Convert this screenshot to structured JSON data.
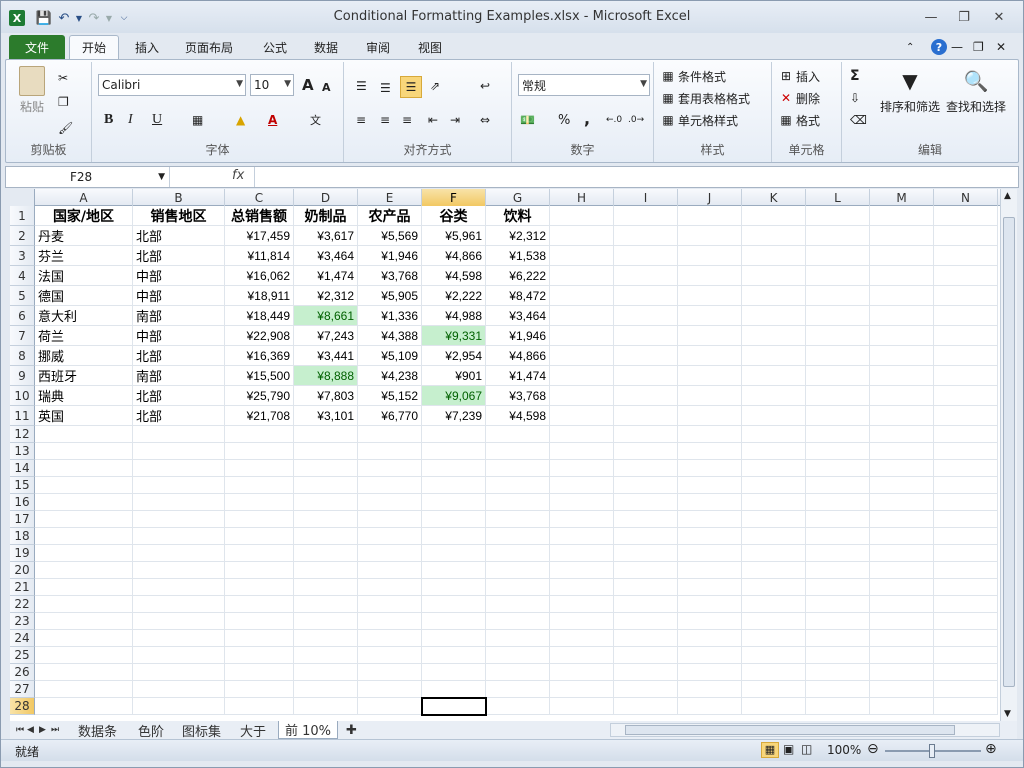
{
  "window": {
    "title": "Conditional Formatting Examples.xlsx - Microsoft Excel",
    "app_icon": "X"
  },
  "ribbon_tabs": [
    "文件",
    "开始",
    "插入",
    "页面布局",
    "公式",
    "数据",
    "审阅",
    "视图"
  ],
  "active_tab": "开始",
  "clipboard": {
    "paste": "粘贴",
    "label": "剪贴板"
  },
  "font": {
    "name": "Calibri",
    "size": "10",
    "label": "字体",
    "bold": "B",
    "italic": "I",
    "underline": "U",
    "grow": "A",
    "shrink": "A"
  },
  "align": {
    "label": "对齐方式"
  },
  "number": {
    "format": "常规",
    "label": "数字",
    "percent": "%",
    "comma": ","
  },
  "styles": {
    "cond": "条件格式",
    "table": "套用表格格式",
    "cell": "单元格样式",
    "label": "样式"
  },
  "cells_grp": {
    "insert": "插入",
    "delete": "删除",
    "format": "格式",
    "label": "单元格"
  },
  "edit": {
    "sort": "排序和筛选",
    "find": "查找和选择",
    "label": "编辑",
    "sum": "Σ"
  },
  "formula_bar": {
    "name_box": "F28",
    "fx": "fx",
    "value": ""
  },
  "columns": [
    "A",
    "B",
    "C",
    "D",
    "E",
    "F",
    "G",
    "H",
    "I",
    "J",
    "K",
    "L",
    "M",
    "N"
  ],
  "selected_column": "F",
  "selected_row": "28",
  "row_numbers": [
    "1",
    "2",
    "3",
    "4",
    "5",
    "6",
    "7",
    "8",
    "9",
    "10",
    "11",
    "12",
    "13",
    "14",
    "15",
    "16",
    "17",
    "18",
    "19",
    "20",
    "21",
    "22",
    "23",
    "24",
    "25",
    "26",
    "27",
    "28"
  ],
  "headers": [
    "国家/地区",
    "销售地区",
    "总销售额",
    "奶制品",
    "农产品",
    "谷类",
    "饮料"
  ],
  "rows": [
    [
      "丹麦",
      "北部",
      "¥17,459",
      "¥3,617",
      "¥5,569",
      "¥5,961",
      "¥2,312"
    ],
    [
      "芬兰",
      "北部",
      "¥11,814",
      "¥3,464",
      "¥1,946",
      "¥4,866",
      "¥1,538"
    ],
    [
      "法国",
      "中部",
      "¥16,062",
      "¥1,474",
      "¥3,768",
      "¥4,598",
      "¥6,222"
    ],
    [
      "德国",
      "中部",
      "¥18,911",
      "¥2,312",
      "¥5,905",
      "¥2,222",
      "¥8,472"
    ],
    [
      "意大利",
      "南部",
      "¥18,449",
      "¥8,661",
      "¥1,336",
      "¥4,988",
      "¥3,464"
    ],
    [
      "荷兰",
      "中部",
      "¥22,908",
      "¥7,243",
      "¥4,388",
      "¥9,331",
      "¥1,946"
    ],
    [
      "挪威",
      "北部",
      "¥16,369",
      "¥3,441",
      "¥5,109",
      "¥2,954",
      "¥4,866"
    ],
    [
      "西班牙",
      "南部",
      "¥15,500",
      "¥8,888",
      "¥4,238",
      "¥901",
      "¥1,474"
    ],
    [
      "瑞典",
      "北部",
      "¥25,790",
      "¥7,803",
      "¥5,152",
      "¥9,067",
      "¥3,768"
    ],
    [
      "英国",
      "北部",
      "¥21,708",
      "¥3,101",
      "¥6,770",
      "¥7,239",
      "¥4,598"
    ]
  ],
  "highlight_cells": [
    "D6",
    "F7",
    "D9",
    "F10"
  ],
  "highlight_colors": {
    "fill": "#c6efce",
    "text": "#006100"
  },
  "sheet_tabs": [
    "数据条",
    "色阶",
    "图标集",
    "大于",
    "前 10%"
  ],
  "active_sheet": "前 10%",
  "status": {
    "ready": "就绪",
    "zoom": "100%"
  }
}
